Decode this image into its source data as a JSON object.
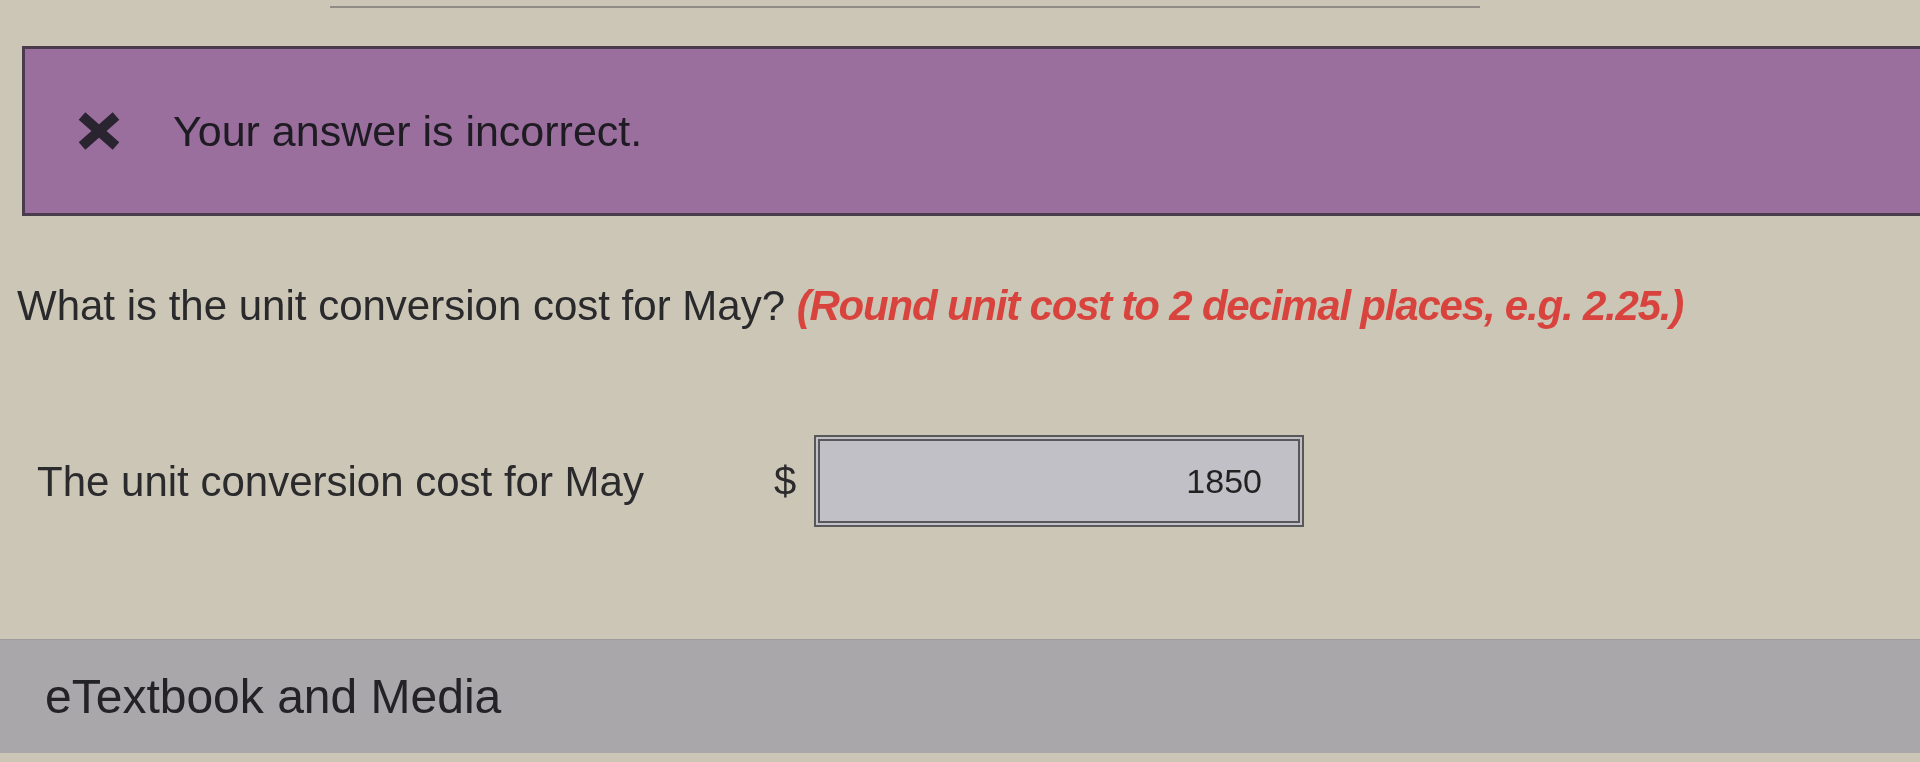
{
  "feedback": {
    "kind": "error",
    "message": "Your answer is incorrect."
  },
  "question": {
    "text": "What is the unit conversion cost for May? **(Round unit cost to 2 decimal places, e.g. 2.25.)**"
  },
  "answer": {
    "label": "The unit conversion cost for May",
    "currency": "$",
    "value": "1850"
  },
  "footer": {
    "title": "eTextbook and Media"
  }
}
